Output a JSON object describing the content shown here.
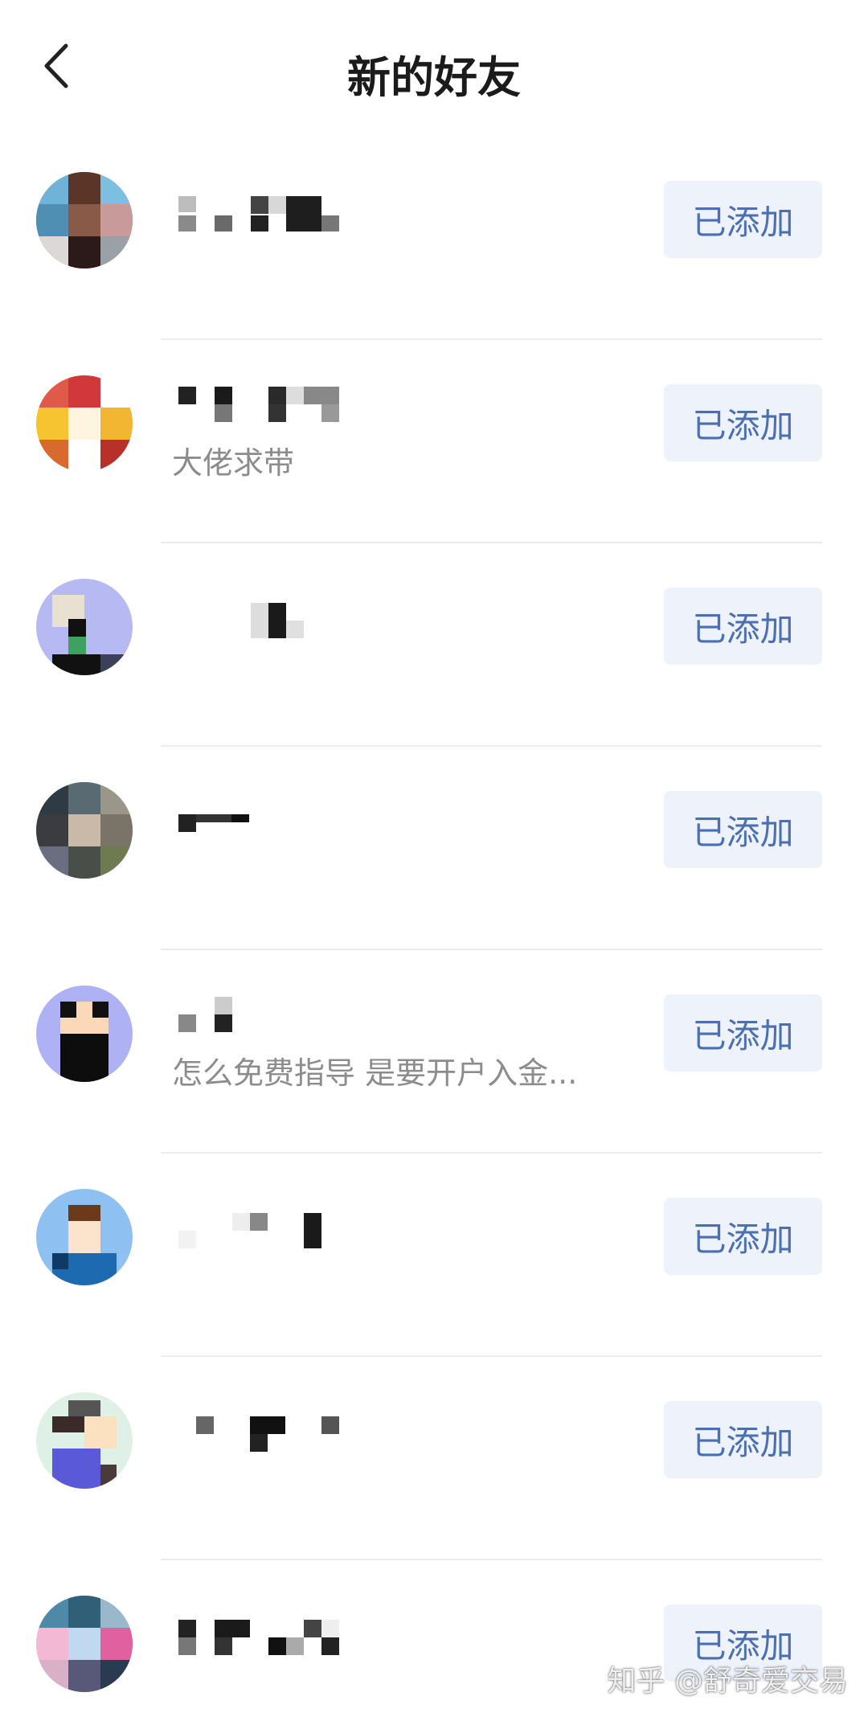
{
  "header": {
    "title": "新的好友",
    "back_icon": "chevron-left-icon"
  },
  "friends": [
    {
      "subtitle": "",
      "button": "已添加"
    },
    {
      "subtitle": "大佬求带",
      "button": "已添加"
    },
    {
      "subtitle": "",
      "button": "已添加"
    },
    {
      "subtitle": "",
      "button": "已添加"
    },
    {
      "subtitle": "怎么免费指导 是要开户入金...",
      "button": "已添加"
    },
    {
      "subtitle": "",
      "button": "已添加"
    },
    {
      "subtitle": "",
      "button": "已添加"
    },
    {
      "subtitle": "",
      "button": "已添加"
    }
  ],
  "watermark": "知乎 @舒奇爱交易",
  "colors": {
    "button_bg": "#eef2fb",
    "button_text": "#4a6fb3",
    "subtitle": "#8c8c8c",
    "title": "#1b1b1b"
  }
}
